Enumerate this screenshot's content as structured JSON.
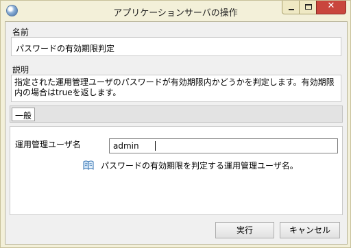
{
  "window": {
    "title": "アプリケーションサーバの操作",
    "app_icon": "globe-icon",
    "controls": {
      "minimize": "minimize-icon",
      "maximize": "maximize-icon",
      "close": "✕"
    }
  },
  "name_section": {
    "label": "名前",
    "value": "パスワードの有効期限判定"
  },
  "description_section": {
    "label": "説明",
    "text": "指定された運用管理ユーザのパスワードが有効期限内かどうかを判定します。有効期限内の場合はtrueを返します。"
  },
  "tabs": [
    {
      "label": "一般"
    }
  ],
  "parameters": [
    {
      "label": "運用管理ユーザ名",
      "value": "admin",
      "hint_icon": "book-icon",
      "hint": "パスワードの有効期限を判定する運用管理ユーザ名。"
    }
  ],
  "buttons": {
    "run": "実行",
    "cancel": "キャンセル"
  },
  "colors": {
    "window_frame": "#f3f0d9",
    "close_button": "#c9463d",
    "panel_background": "#ffffff"
  }
}
